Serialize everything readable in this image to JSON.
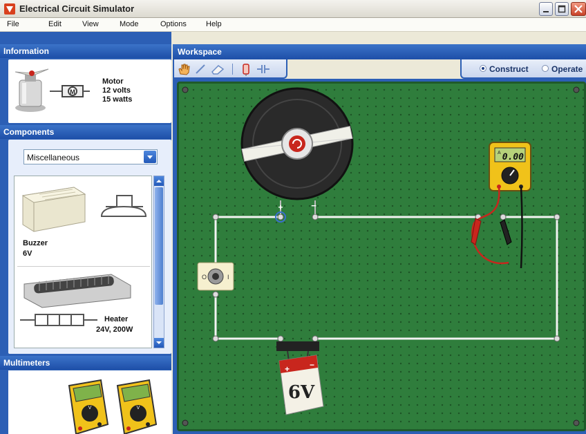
{
  "window": {
    "title": "Electrical Circuit Simulator"
  },
  "menu": [
    "File",
    "Edit",
    "View",
    "Mode",
    "Options",
    "Help"
  ],
  "information": {
    "header": "Information",
    "name": "Motor",
    "voltage": "12 volts",
    "power": "15 watts",
    "symbol_letter": "M"
  },
  "components": {
    "header": "Components",
    "category": "Miscellaneous",
    "items": [
      {
        "name": "Buzzer",
        "spec": "6V"
      },
      {
        "name": "Heater",
        "spec": "24V, 200W"
      }
    ]
  },
  "multimeters": {
    "header": "Multimeters"
  },
  "workspace": {
    "header": "Workspace",
    "tools": [
      "hand-icon",
      "wire-icon",
      "eraser-icon",
      "resistor-icon",
      "capacitor-icon"
    ],
    "modes": [
      {
        "label": "Construct",
        "selected": true
      },
      {
        "label": "Operate",
        "selected": false
      }
    ]
  },
  "circuit": {
    "battery_label": "6V",
    "battery_plus": "+",
    "battery_minus": "−",
    "motor_plus": "+",
    "motor_minus": "−",
    "meter_reading": "0.00",
    "meter_unit": "A",
    "switch_off": "O",
    "switch_on": "I"
  },
  "colors": {
    "panel_blue": "#2c5fb5",
    "board_green": "#2f7d3c",
    "meter_yellow": "#f0c21a",
    "battery_red": "#c8261d"
  }
}
